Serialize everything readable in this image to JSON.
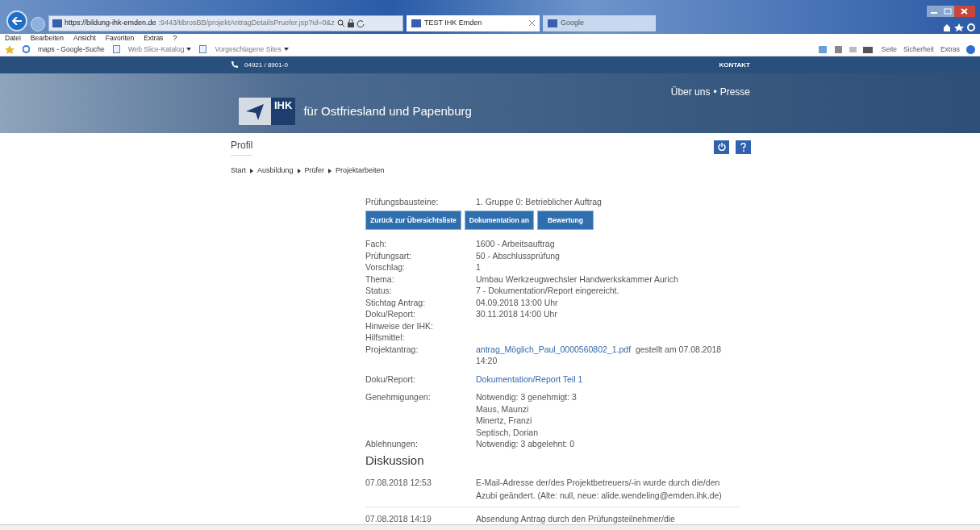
{
  "browser": {
    "url_host": "https://bildung-ihk-emden.de",
    "url_rest": ":9443/tibrosBB/projektAntragDetailsPruefer.jsp?id=0&z",
    "tabs": [
      {
        "title": "TEST IHK Emden",
        "selected": true
      },
      {
        "title": "Google",
        "selected": false
      }
    ],
    "menu": [
      "Datei",
      "Bearbeiten",
      "Ansicht",
      "Favoriten",
      "Extras",
      "?"
    ],
    "favorites": [
      {
        "label": "maps - Google-Suche",
        "dropdown": false
      },
      {
        "label": "Web Slice-Katalog",
        "dropdown": true
      },
      {
        "label": "Vorgeschlagene Sites",
        "dropdown": true
      }
    ],
    "commands": [
      "Seite",
      "Sicherheit",
      "Extras"
    ]
  },
  "site": {
    "phone": "04921 / 8901-0",
    "contact": "KONTAKT",
    "top_links": [
      "Über uns",
      "Presse"
    ],
    "separator": "•",
    "logo": "IHK",
    "tagline": "für Ostfriesland und Papenburg"
  },
  "page_title": "Profil",
  "breadcrumb": [
    "Start",
    "Ausbildung",
    "Prüfer",
    "Projektarbeiten"
  ],
  "details_top": [
    {
      "label": "Prüfungsbausteine:",
      "value": "1. Gruppe 0: Betrieblicher Auftrag"
    }
  ],
  "buttons": [
    "Zurück zur Übersichtsliste",
    "Dokumentation an",
    "Bewertung"
  ],
  "details": [
    {
      "kind": "text",
      "label": "Fach:",
      "value": "1600 - Arbeitsauftrag"
    },
    {
      "kind": "text",
      "label": "Prüfungsart:",
      "value": "50 - Abschlussprüfung"
    },
    {
      "kind": "text",
      "label": "Vorschlag:",
      "value": "1"
    },
    {
      "kind": "text",
      "label": "Thema:",
      "value": "Umbau Werkzeugwechsler Handwerkskammer Aurich"
    },
    {
      "kind": "text",
      "label": "Status:",
      "value": "7 - Dokumentation/Report eingereicht."
    },
    {
      "kind": "text",
      "label": "Stichtag Antrag:",
      "value": "04.09.2018 13:00 Uhr"
    },
    {
      "kind": "text",
      "label": "Doku/Report:",
      "value": "30.11.2018 14:00 Uhr"
    },
    {
      "kind": "text",
      "label": "Hinweise der IHK:"
    },
    {
      "kind": "text",
      "label": "Hilfsmittel:"
    },
    {
      "kind": "link",
      "label": "Projektantrag:",
      "link": "antrag_Möglich_Paul_0000560802_1.pdf",
      "note": "gestellt am 07.08.2018 14:20"
    },
    {
      "kind": "link",
      "label": "Doku/Report:",
      "link": "Dokumentation/Report Teil 1"
    },
    {
      "kind": "list",
      "label": "Genehmigungen:",
      "lines": [
        "Notwendig: 3 genehmigt:  3",
        "Maus, Maunzi",
        "Minertz, Franzi",
        "Septisch, Dorian"
      ]
    },
    {
      "kind": "text",
      "label": "Ablehnungen:",
      "value": "Notwendig: 3 abgelehnt:  0"
    }
  ],
  "discussion": {
    "title": "Diskussion",
    "entries": [
      {
        "time": "07.08.2018 12:53",
        "text": "E-Mail-Adresse der/des Projektbetreuers/-in wurde durch die/den Azubi geändert. (Alte: null, neue: alide.wendeling@emden.ihk.de)"
      },
      {
        "time": "07.08.2018 14:19",
        "text": "Absendung Antrag durch den Prüfungsteilnehmer/die"
      }
    ]
  }
}
